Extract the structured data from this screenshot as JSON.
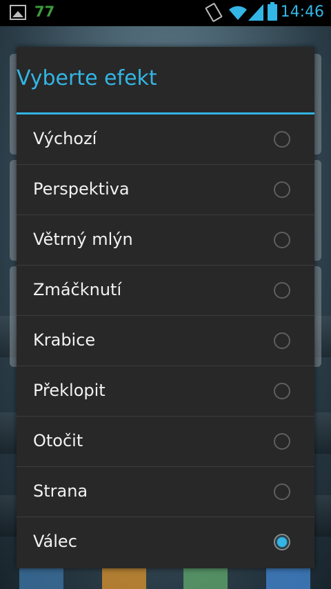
{
  "status_bar": {
    "notification_count": "77",
    "time": "14:46",
    "icons": [
      "gallery-icon",
      "vibrate-icon",
      "wifi-icon",
      "signal-icon",
      "battery-icon"
    ],
    "accent_color": "#33b5e5"
  },
  "dialog": {
    "title": "Vyberte efekt",
    "accent_color": "#33b5e5",
    "options": [
      {
        "label": "Výchozí",
        "selected": false
      },
      {
        "label": "Perspektiva",
        "selected": false
      },
      {
        "label": "Větrný mlýn",
        "selected": false
      },
      {
        "label": "Zmáčknutí",
        "selected": false
      },
      {
        "label": "Krabice",
        "selected": false
      },
      {
        "label": "Překlopit",
        "selected": false
      },
      {
        "label": "Otočit",
        "selected": false
      },
      {
        "label": "Strana",
        "selected": false
      },
      {
        "label": "Válec",
        "selected": true
      }
    ]
  }
}
